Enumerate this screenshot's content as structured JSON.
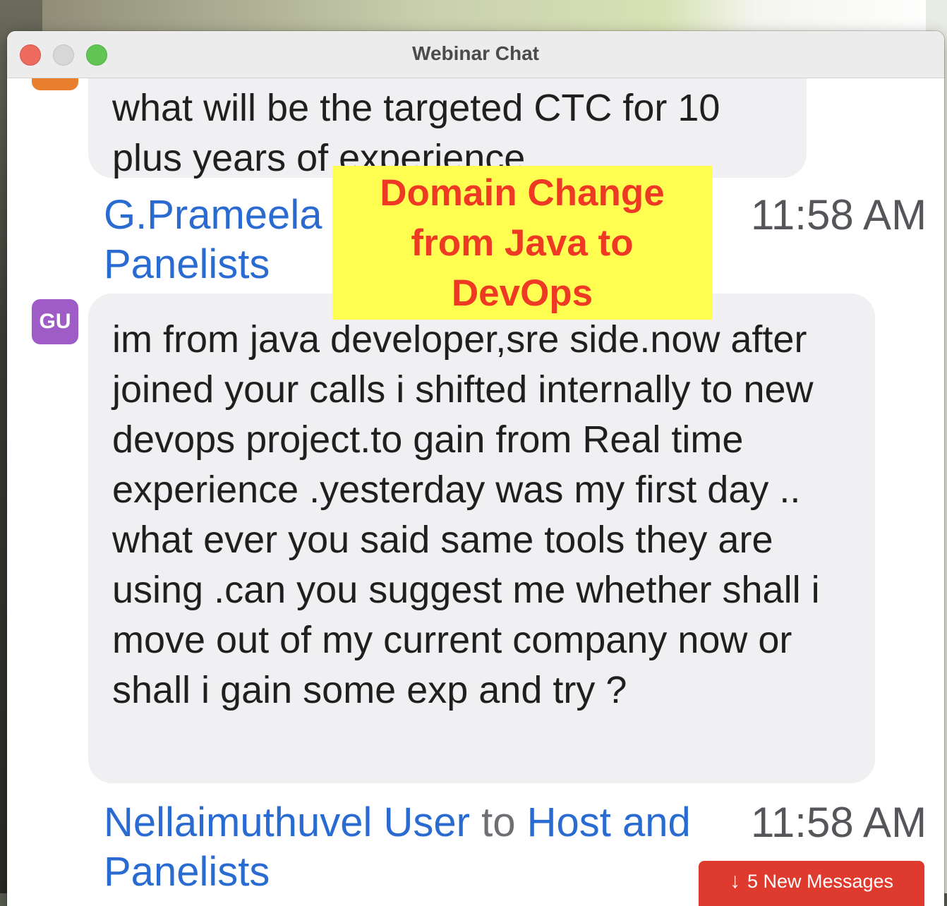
{
  "window": {
    "title": "Webinar Chat"
  },
  "colors": {
    "link_blue": "#2a6bd2",
    "bubble_bg": "#f0f0f3",
    "overlay_bg": "#ffff52",
    "overlay_text": "#ee3a24",
    "new_messages_bg": "#de3a2d",
    "avatar_gu": "#9f5bc6",
    "avatar_partial": "#e87f2e"
  },
  "messages": [
    {
      "avatar": "",
      "text": "what will be the targeted CTC for 10\nplus years of experience"
    },
    {
      "sender": "G.Prameela U",
      "line2": "Panelists",
      "time": "11:58 AM",
      "avatar": "GU",
      "text": "im from java developer,sre side.now after joined your calls i shifted internally to new devops project.to gain from Real time experience .yesterday was my first day .. what ever you said same tools they are using .can you suggest me whether shall i move out of my current company now or shall i gain some exp and try ?"
    },
    {
      "sender": "Nellaimuthuvel User",
      "connector": "to",
      "recipient": "Host and",
      "line2": "Panelists",
      "time": "11:58 AM"
    }
  ],
  "overlay": {
    "text": "Domain Change from Java to DevOps"
  },
  "new_messages": {
    "icon": "arrow-down-icon",
    "label": "5 New Messages"
  }
}
